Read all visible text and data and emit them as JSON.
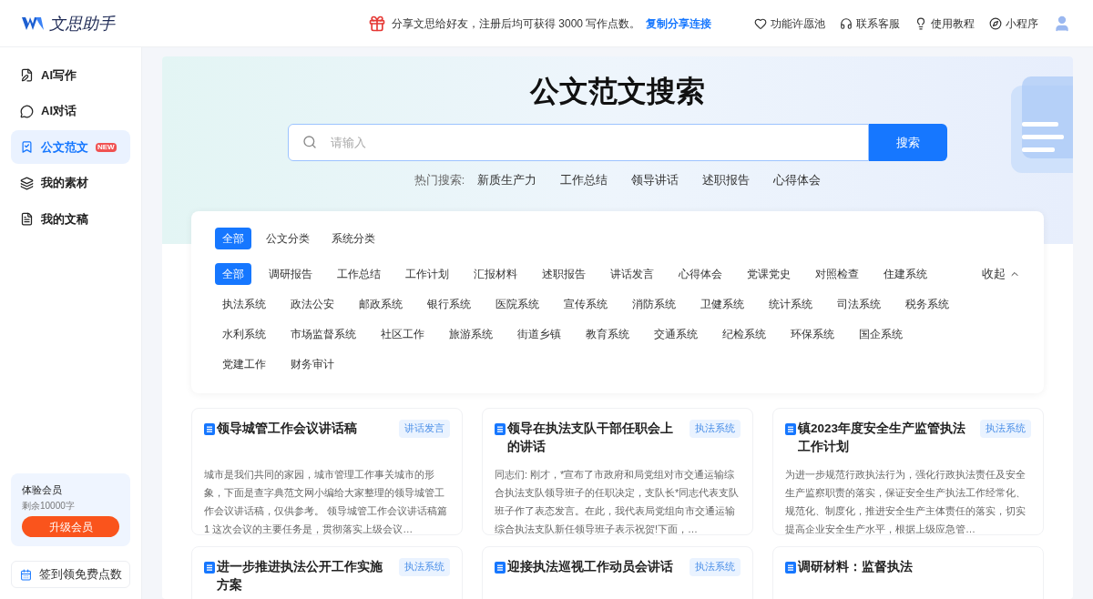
{
  "header": {
    "logo_text": "文思助手",
    "promo_text": "分享文思给好友，注册后均可获得 3000 写作点数。",
    "promo_link": "复制分享连接",
    "links": [
      {
        "label": "功能许愿池"
      },
      {
        "label": "联系客服"
      },
      {
        "label": "使用教程"
      },
      {
        "label": "小程序"
      }
    ]
  },
  "sidebar": {
    "items": [
      {
        "label": "AI写作",
        "selected": false
      },
      {
        "label": "AI对话",
        "selected": false
      },
      {
        "label": "公文范文",
        "selected": true,
        "badge": "NEW"
      },
      {
        "label": "我的素材",
        "selected": false
      },
      {
        "label": "我的文稿",
        "selected": false
      }
    ],
    "member": {
      "title": "体验会员",
      "remaining": "剩余10000字",
      "button": "升级会员"
    },
    "checkin": "签到领免费点数"
  },
  "hero": {
    "title": "公文范文搜索",
    "search": {
      "placeholder": "请输入",
      "button": "搜索"
    },
    "hot_label": "热门搜索:",
    "hot": [
      "新质生产力",
      "工作总结",
      "领导讲话",
      "述职报告",
      "心得体会"
    ]
  },
  "filters": {
    "groups": [
      {
        "label": "全部",
        "selected": true
      },
      {
        "label": "公文分类",
        "selected": false
      },
      {
        "label": "系统分类",
        "selected": false
      }
    ],
    "categories": [
      {
        "label": "全部",
        "selected": true
      },
      {
        "label": "调研报告",
        "selected": false
      },
      {
        "label": "工作总结",
        "selected": false
      },
      {
        "label": "工作计划",
        "selected": false
      },
      {
        "label": "汇报材料",
        "selected": false
      },
      {
        "label": "述职报告",
        "selected": false
      },
      {
        "label": "讲话发言",
        "selected": false
      },
      {
        "label": "心得体会",
        "selected": false
      },
      {
        "label": "党课党史",
        "selected": false
      },
      {
        "label": "对照检查",
        "selected": false
      },
      {
        "label": "住建系统",
        "selected": false
      },
      {
        "label": "执法系统",
        "selected": false
      },
      {
        "label": "政法公安",
        "selected": false
      },
      {
        "label": "邮政系统",
        "selected": false
      },
      {
        "label": "银行系统",
        "selected": false
      },
      {
        "label": "医院系统",
        "selected": false
      },
      {
        "label": "宣传系统",
        "selected": false
      },
      {
        "label": "消防系统",
        "selected": false
      },
      {
        "label": "卫健系统",
        "selected": false
      },
      {
        "label": "统计系统",
        "selected": false
      },
      {
        "label": "司法系统",
        "selected": false
      },
      {
        "label": "税务系统",
        "selected": false
      },
      {
        "label": "水利系统",
        "selected": false
      },
      {
        "label": "市场监督系统",
        "selected": false
      },
      {
        "label": "社区工作",
        "selected": false
      },
      {
        "label": "旅游系统",
        "selected": false
      },
      {
        "label": "街道乡镇",
        "selected": false
      },
      {
        "label": "教育系统",
        "selected": false
      },
      {
        "label": "交通系统",
        "selected": false
      },
      {
        "label": "纪检系统",
        "selected": false
      },
      {
        "label": "环保系统",
        "selected": false
      },
      {
        "label": "国企系统",
        "selected": false
      },
      {
        "label": "党建工作",
        "selected": false
      },
      {
        "label": "财务审计",
        "selected": false
      }
    ],
    "collapse": "收起"
  },
  "articles": [
    {
      "title": "领导城管工作会议讲话稿",
      "tag": "讲话发言",
      "summary": "城市是我们共同的家园，城市管理工作事关城市的形象，下面是查字典范文网小编给大家整理的领导城管工作会议讲话稿，仅供参考。 领导城管工作会议讲话稿篇1 这次会议的主要任务是，贯彻落实上级会议…"
    },
    {
      "title": "领导在执法支队干部任职会上的讲话",
      "tag": "执法系统",
      "summary": "同志们: 刚才，*宣布了市政府和局党组对市交通运输综合执法支队领导班子的任职决定，支队长*同志代表支队班子作了表态发言。在此，我代表局党组向市交通运输综合执法支队新任领导班子表示祝贺!下面，…"
    },
    {
      "title": "镇2023年度安全生产监管执法工作计划",
      "tag": "执法系统",
      "summary": "为进一步规范行政执法行为，强化行政执法责任及安全生产监察职责的落实，保证安全生产执法工作经常化、规范化、制度化，推进安全生产主体责任的落实，切实提高企业安全生产水平，根据上级应急管…"
    },
    {
      "title": "进一步推进执法公开工作实施方案",
      "tag": "执法系统"
    },
    {
      "title": "迎接执法巡视工作动员会讲话",
      "tag": "执法系统"
    },
    {
      "title": "调研材料：监督执法"
    }
  ]
}
